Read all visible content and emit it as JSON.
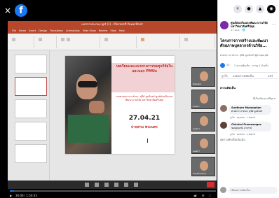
{
  "viewer": {
    "close_glyph": "×",
    "logo_glyph": "f",
    "ppt": {
      "window_title": "เอกสารประกอบ ppt (1) - Microsoft PowerPoint",
      "ribbon_tabs": [
        "File",
        "Home",
        "Insert",
        "Design",
        "Transitions",
        "Animations",
        "Slide Show",
        "Review",
        "View",
        "Help"
      ],
      "slide": {
        "title": "บทเรียนและแนวทางการขอทุนวิจัยในและนอก PMUs",
        "presenter": "รองศาสตราจารย์ ดร. สุนีย์ มูลจันทร์ ศูนย์ส่งเสริมและพัฒนางานวิจัย มหาวิทยาลัยศรีปทุม",
        "date": "27.04.21",
        "time": "บ่ายสาม พระนคร"
      },
      "webcam_names": [
        "Presenter",
        "Guest 1",
        "Guest 2",
        "Guest 3",
        "Ying Boonsong"
      ]
    },
    "controls": {
      "time": "30:06 / 1:50:33",
      "progress": 0.02,
      "icons": [
        "play-icon",
        "volume-icon",
        "settings-icon",
        "fullscreen-icon"
      ]
    }
  },
  "panel": {
    "topbar_glyphs": [
      "+",
      "●",
      "▲",
      "◉"
    ],
    "page_name": "ศูนย์ส่งเสริมและพัฒนางานวิจัย มหาวิทยาลัยศรีปทุม",
    "page_sub": "27 เม.ย. · 🌐",
    "more_glyph": "···",
    "post_title": "โครงการการสร้างและพัฒนาศักยภาพบุคลากรด้านวิจัย...",
    "post_body": "ศาสตราจารย์ ดร. สุนีย์ มูลจันทร์ ผู้ทรงคุณวุฒิ",
    "reactions": {
      "count": "20",
      "stats": "2 ความคิดเห็น · การดู 119 ครั้ง"
    },
    "actions": [
      "ถูกใจ",
      "แสดงความคิดเห็น",
      "แชร์"
    ],
    "comments_label": "ความคิดเห็น",
    "relevance": "ที่เกี่ยวข้องมากที่สุด ▾",
    "comments": [
      {
        "name": "Sunthorn Mueanphon",
        "text": "ศาสตราจารย์ ดร. สุนีย์ มูลจันทร์",
        "meta": "ถูกใจ · ตอบกลับ · 2 สัปดาห์"
      },
      {
        "name": "Chirchai Promwongsa",
        "text": "ขอบคุณครับ อาจารย์",
        "meta": "ถูกใจ · ตอบกลับ · 2 สัปดาห์"
      }
    ],
    "more_comments": "ดูความคิดเห็นเพิ่มเติม",
    "composer_placeholder": "เขียนความคิดเห็น..."
  }
}
